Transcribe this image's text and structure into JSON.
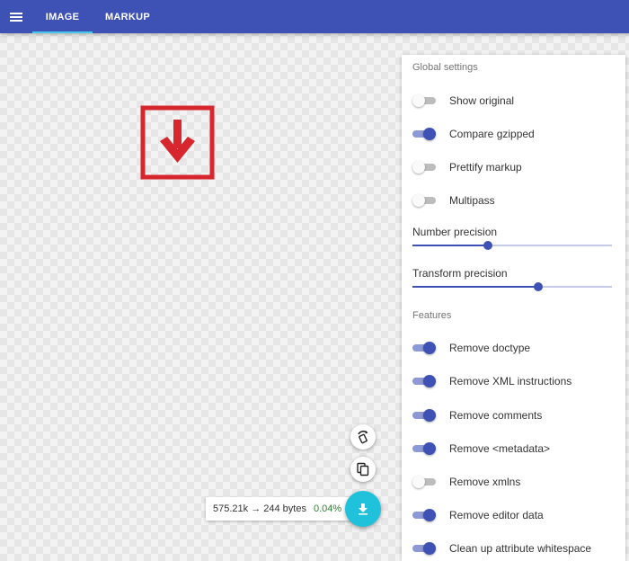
{
  "header": {
    "tabs": [
      {
        "label": "IMAGE",
        "active": true
      },
      {
        "label": "MARKUP",
        "active": false
      }
    ],
    "accent_color": "#3e51b5",
    "tab_indicator_color": "#45c7ee"
  },
  "preview": {
    "icon": "download-arrow-icon",
    "color": "#d7262e"
  },
  "settings": {
    "global_title": "Global settings",
    "global_toggles": [
      {
        "label": "Show original",
        "on": false
      },
      {
        "label": "Compare gzipped",
        "on": true
      },
      {
        "label": "Prettify markup",
        "on": false
      },
      {
        "label": "Multipass",
        "on": false
      }
    ],
    "sliders": [
      {
        "label": "Number precision",
        "level": 0.38
      },
      {
        "label": "Transform precision",
        "level": 0.63
      }
    ],
    "features_title": "Features",
    "features": [
      {
        "label": "Remove doctype",
        "on": true
      },
      {
        "label": "Remove XML instructions",
        "on": true
      },
      {
        "label": "Remove comments",
        "on": true
      },
      {
        "label": "Remove <metadata>",
        "on": true
      },
      {
        "label": "Remove xmlns",
        "on": false
      },
      {
        "label": "Remove editor data",
        "on": true
      },
      {
        "label": "Clean up attribute whitespace",
        "on": true
      }
    ]
  },
  "output": {
    "size_text": "575.21k → 244 bytes",
    "percent": "0.04%",
    "percent_color": "#2e7d32",
    "download_color": "#1fc2da"
  }
}
